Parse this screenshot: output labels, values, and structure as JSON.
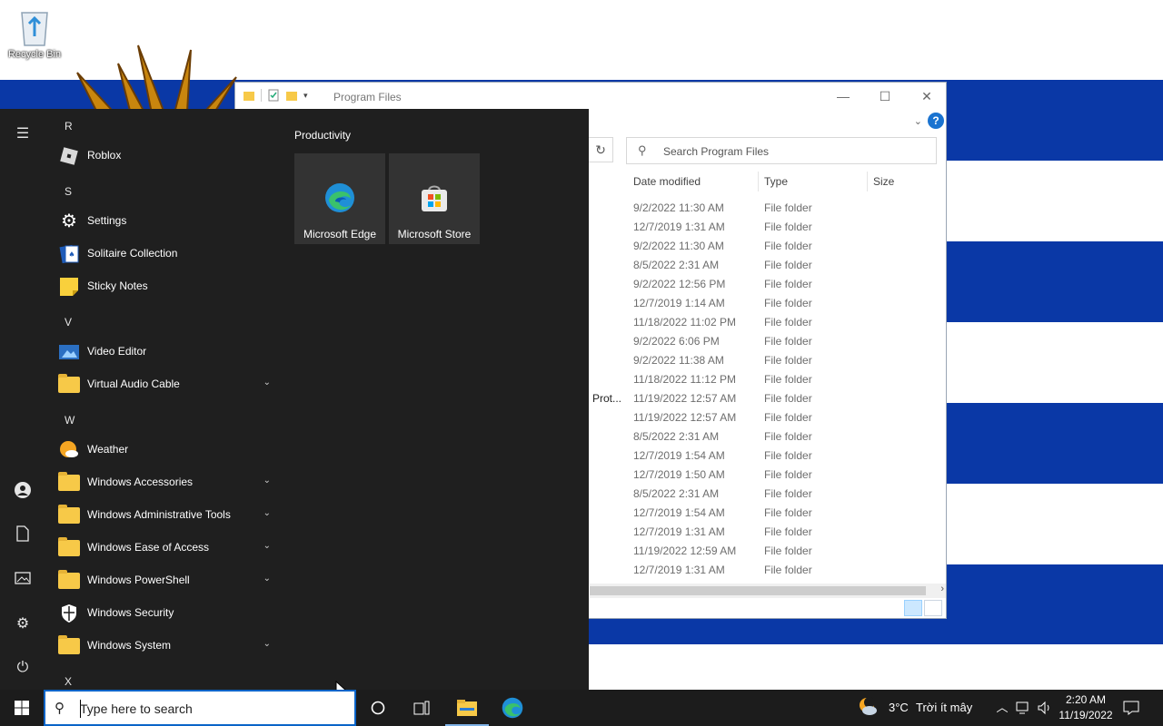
{
  "desktop": {
    "recycle_bin_label": "Recycle Bin"
  },
  "explorer": {
    "title": "Program Files",
    "search_placeholder": "Search Program Files",
    "columns": {
      "date_modified": "Date modified",
      "type": "Type",
      "size": "Size"
    },
    "visible_name_fragment": "Prot...",
    "rows": [
      {
        "date": "9/2/2022 11:30 AM",
        "type": "File folder"
      },
      {
        "date": "12/7/2019 1:31 AM",
        "type": "File folder"
      },
      {
        "date": "9/2/2022 11:30 AM",
        "type": "File folder"
      },
      {
        "date": "8/5/2022 2:31 AM",
        "type": "File folder"
      },
      {
        "date": "9/2/2022 12:56 PM",
        "type": "File folder"
      },
      {
        "date": "12/7/2019 1:14 AM",
        "type": "File folder"
      },
      {
        "date": "11/18/2022 11:02 PM",
        "type": "File folder"
      },
      {
        "date": "9/2/2022 6:06 PM",
        "type": "File folder"
      },
      {
        "date": "9/2/2022 11:38 AM",
        "type": "File folder"
      },
      {
        "date": "11/18/2022 11:12 PM",
        "type": "File folder"
      },
      {
        "date": "11/19/2022 12:57 AM",
        "type": "File folder"
      },
      {
        "date": "11/19/2022 12:57 AM",
        "type": "File folder"
      },
      {
        "date": "8/5/2022 2:31 AM",
        "type": "File folder"
      },
      {
        "date": "12/7/2019 1:54 AM",
        "type": "File folder"
      },
      {
        "date": "12/7/2019 1:50 AM",
        "type": "File folder"
      },
      {
        "date": "8/5/2022 2:31 AM",
        "type": "File folder"
      },
      {
        "date": "12/7/2019 1:54 AM",
        "type": "File folder"
      },
      {
        "date": "12/7/2019 1:31 AM",
        "type": "File folder"
      },
      {
        "date": "11/19/2022 12:59 AM",
        "type": "File folder"
      },
      {
        "date": "12/7/2019 1:31 AM",
        "type": "File folder"
      }
    ]
  },
  "start_menu": {
    "letters": {
      "r": "R",
      "s": "S",
      "v": "V",
      "w": "W",
      "x": "X"
    },
    "apps": {
      "roblox": "Roblox",
      "settings": "Settings",
      "solitaire": "Solitaire Collection",
      "sticky_notes": "Sticky Notes",
      "video_editor": "Video Editor",
      "virtual_audio_cable": "Virtual Audio Cable",
      "weather": "Weather",
      "windows_accessories": "Windows Accessories",
      "windows_admin_tools": "Windows Administrative Tools",
      "windows_ease_of_access": "Windows Ease of Access",
      "windows_powershell": "Windows PowerShell",
      "windows_security": "Windows Security",
      "windows_system": "Windows System"
    },
    "group_title": "Productivity",
    "tiles": {
      "edge": "Microsoft Edge",
      "store": "Microsoft Store"
    }
  },
  "taskbar": {
    "search_placeholder": "Type here to search",
    "weather_temp": "3°C",
    "weather_desc": "Trời ít mây",
    "time": "2:20 AM",
    "date": "11/19/2022"
  }
}
